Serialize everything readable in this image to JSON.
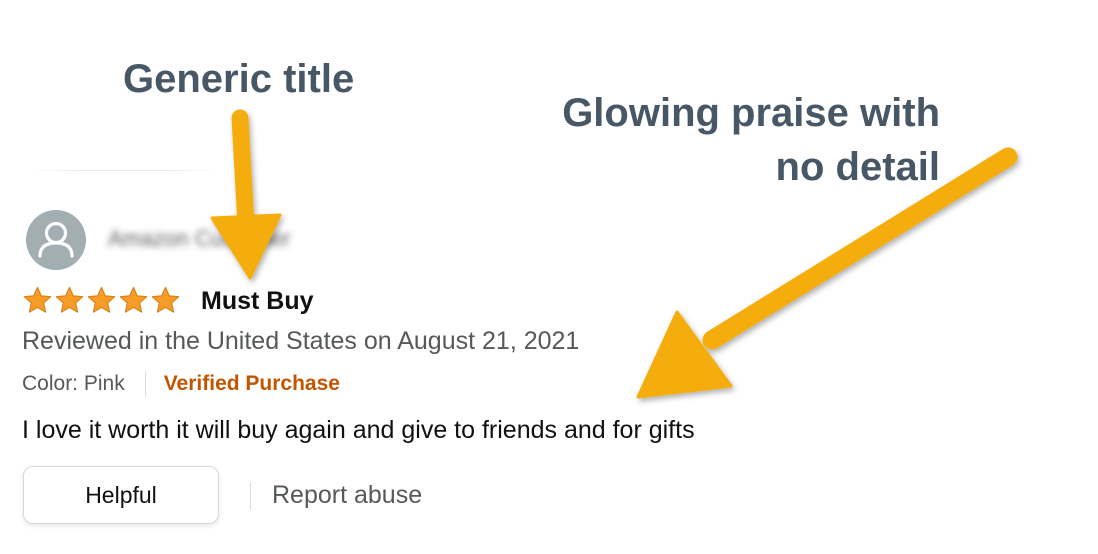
{
  "annotations": {
    "callout_1": "Generic title",
    "callout_2_line1": "Glowing praise with",
    "callout_2_line2": "no detail",
    "arrow_color": "#f5ac0c",
    "text_color": "#475766"
  },
  "review": {
    "reviewer_name": "Amazon Customer",
    "avatar_icon": "user-icon",
    "rating": 5,
    "rating_max": 5,
    "star_color": "#f79b29",
    "title": "Must Buy",
    "date_line": "Reviewed in the United States on August 21, 2021",
    "color_variant": "Color: Pink",
    "verified_label": "Verified Purchase",
    "verified_color": "#c45500",
    "body": "I love it worth it will buy again and give to friends and for gifts",
    "helpful_label": "Helpful",
    "report_label": "Report abuse"
  }
}
